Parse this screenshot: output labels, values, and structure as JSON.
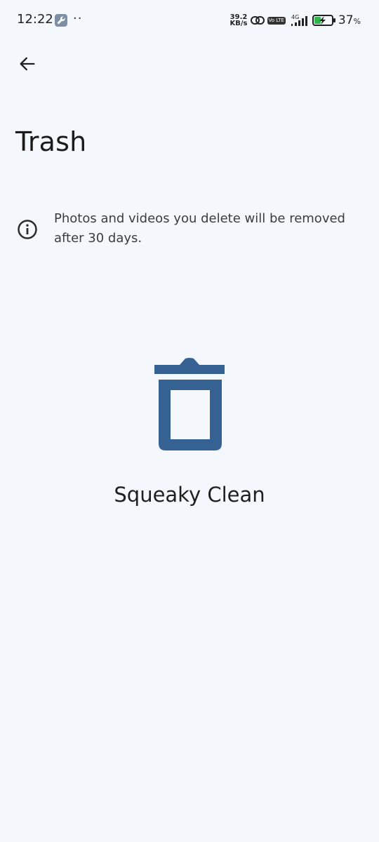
{
  "status_bar": {
    "time": "12:22",
    "more_notifications": "··",
    "net_speed_value": "39.2",
    "net_speed_unit": "KB/s",
    "network_type": "4G",
    "volte": "Vo LTE",
    "battery_percent": "37",
    "battery_percent_sign": "%",
    "battery_level": 0.37,
    "icons": [
      "wrench-icon",
      "link-icon",
      "signal-icon",
      "battery-charging-icon"
    ]
  },
  "header": {
    "back_icon": "arrow-back-icon",
    "title": "Trash"
  },
  "info": {
    "icon": "info-icon",
    "message": "Photos and videos you delete will be removed after 30 days."
  },
  "empty_state": {
    "icon": "trash-bin-icon",
    "label": "Squeaky Clean"
  },
  "colors": {
    "background": "#f4f8fc",
    "accent": "#356293",
    "text": "#1f1f1f",
    "battery_green": "#2eb84b"
  }
}
